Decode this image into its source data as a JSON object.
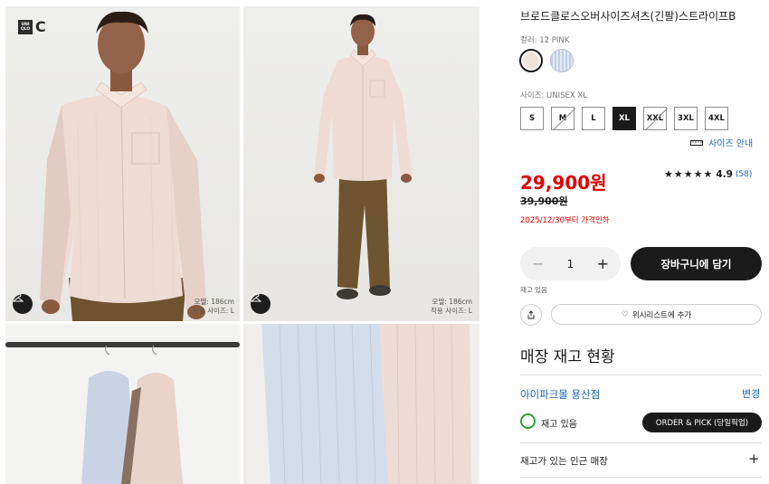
{
  "brand": {
    "logo_box_lines": [
      "UNI",
      "QLO"
    ],
    "logo_letter": "C"
  },
  "gallery": {
    "model_height_1": "모델: 186cm",
    "model_size_1": "착용 사이즈: L",
    "model_height_2": "모델: 186cm",
    "model_size_2": "착용 사이즈: L"
  },
  "product": {
    "name": "브로드클로스오버사이즈셔츠(긴팔)스트라이프B",
    "color_label": "컬러: 12 PINK",
    "colors": [
      {
        "name": "pink",
        "hex": "#efe2dc",
        "selected": true
      },
      {
        "name": "blue",
        "hex": "#c9d3e4",
        "selected": false
      }
    ],
    "size_label": "사이즈: UNISEX XL",
    "sizes": [
      {
        "label": "S",
        "state": "available"
      },
      {
        "label": "M",
        "state": "out"
      },
      {
        "label": "L",
        "state": "available"
      },
      {
        "label": "XL",
        "state": "selected"
      },
      {
        "label": "XXL",
        "state": "out"
      },
      {
        "label": "3XL",
        "state": "available"
      },
      {
        "label": "4XL",
        "state": "available"
      }
    ],
    "size_guide": "사이즈 안내",
    "price": "29,900원",
    "original_price": "39,900원",
    "discount_note": "2025/12/30부터 가격인하",
    "rating_stars": "★★★★★",
    "rating_score": "4.9",
    "review_count": "(58)",
    "quantity": "1",
    "cart_button": "장바구니에 담기",
    "stock_status": "재고 있음",
    "wishlist": "위시리스트에 추가"
  },
  "store": {
    "title": "매장 재고 현황",
    "store_name": "아이파크몰 용산점",
    "change": "변경",
    "availability": "재고 있음",
    "pick_button": "ORDER & PICK (당일픽업)",
    "nearby": "재고가 있는 인근 매장",
    "expand": "+"
  },
  "colors": {
    "sale_red": "#e00000",
    "link_blue": "#1b63b8",
    "stock_green": "#2ea336",
    "dark": "#1b1b1b"
  }
}
